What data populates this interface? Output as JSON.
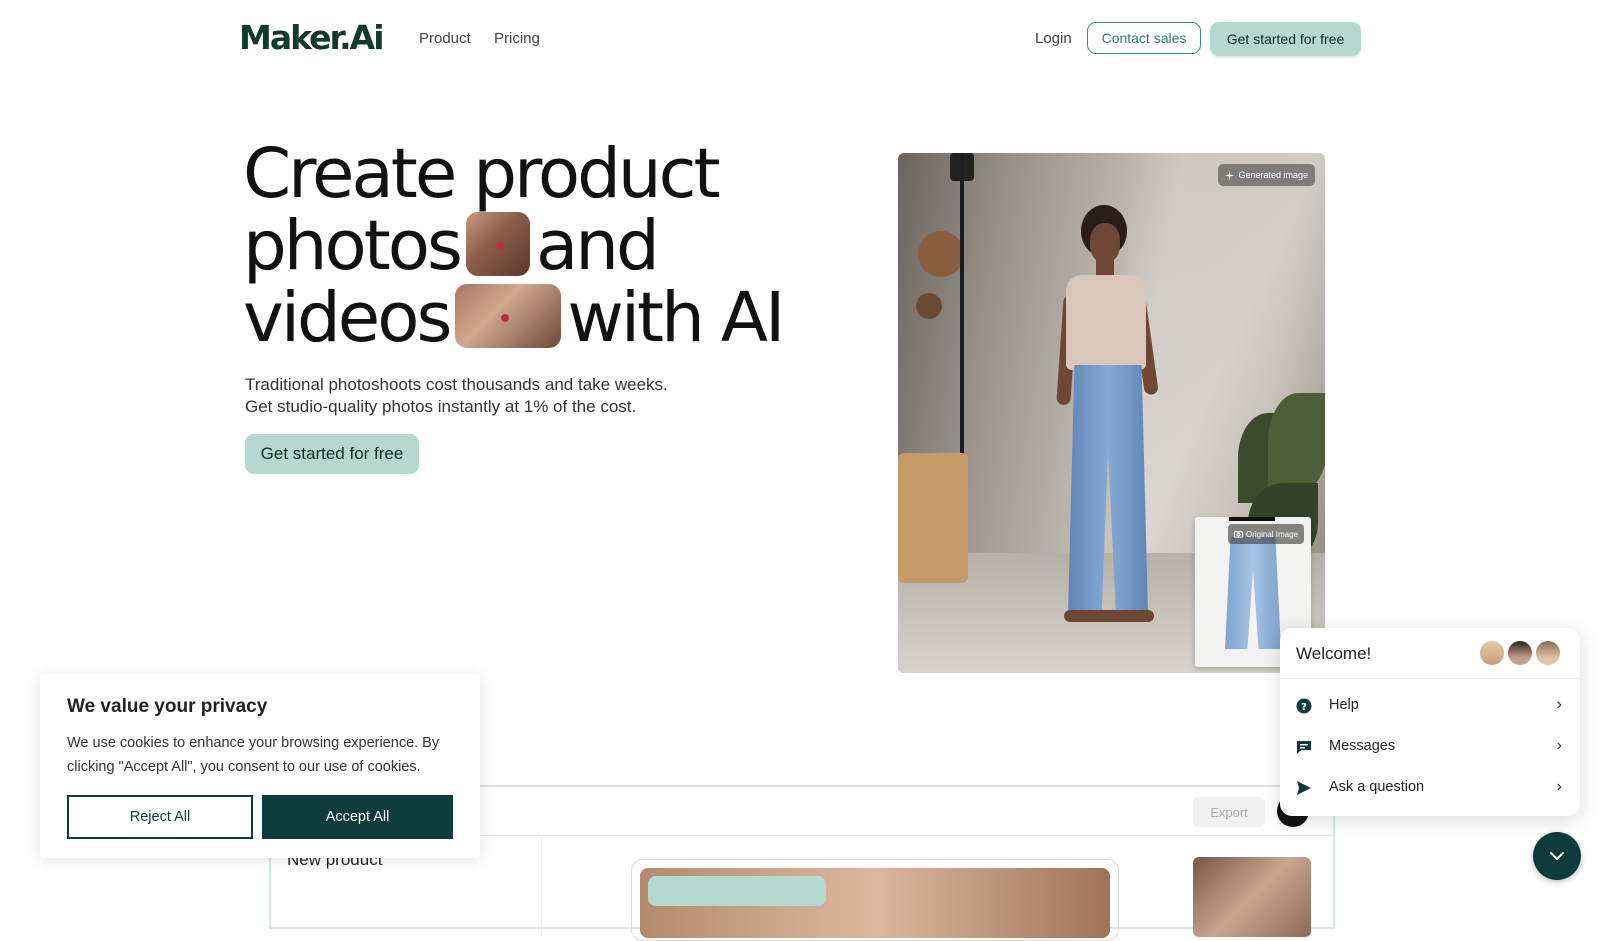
{
  "nav": {
    "logo": "Maker.Ai",
    "links": [
      "Product",
      "Pricing"
    ],
    "login": "Login",
    "contact_sales": "Contact sales",
    "get_started": "Get started for free"
  },
  "hero": {
    "title_line1": "Create product",
    "title_line2_a": "photos",
    "title_line2_b": "and",
    "title_line3_a": "videos",
    "title_line3_b": "with AI",
    "subtitle_line1": "Traditional photoshoots cost thousands and take weeks.",
    "subtitle_line2": "Get studio-quality photos instantly at 1% of the cost.",
    "cta": "Get started for free",
    "generated_badge": "Generated image",
    "original_badge": "Original Image"
  },
  "preview": {
    "export_label": "Export",
    "new_product_label": "New product"
  },
  "cookie": {
    "title": "We value your privacy",
    "text": "We use cookies to enhance your browsing experience. By clicking \"Accept All\", you consent to our use of cookies.",
    "reject": "Reject All",
    "accept": "Accept All"
  },
  "chat": {
    "welcome": "Welcome!",
    "items": [
      {
        "label": "Help",
        "icon": "help-icon"
      },
      {
        "label": "Messages",
        "icon": "messages-icon"
      },
      {
        "label": "Ask a question",
        "icon": "send-icon"
      }
    ]
  },
  "colors": {
    "brand_dark": "#0b3b3a",
    "mint": "#b5d9d1",
    "contact_border": "#3a8a7c"
  }
}
